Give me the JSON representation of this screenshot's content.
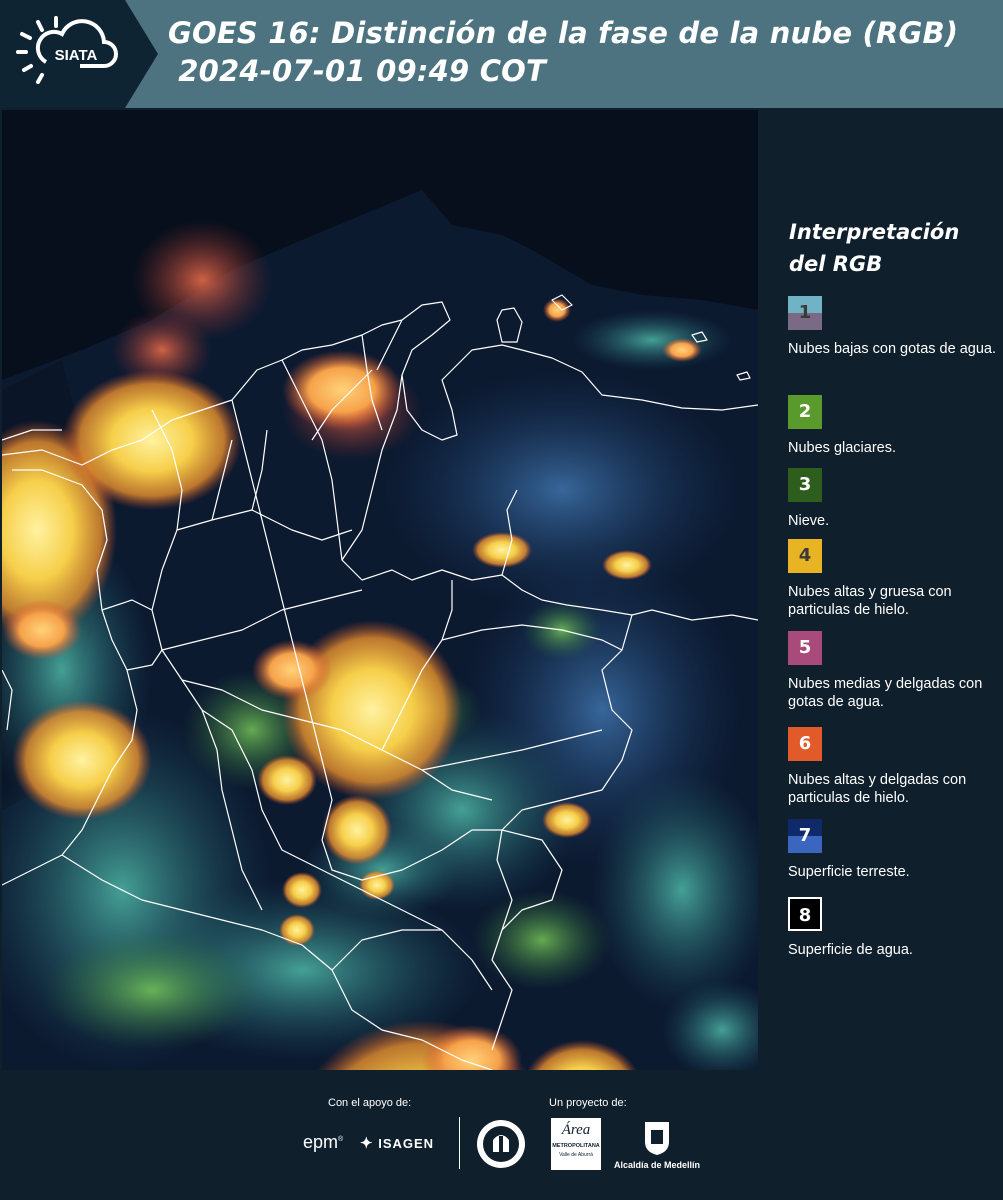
{
  "header": {
    "title_line1": "GOES 16: Distinción de la fase de la nube (RGB)",
    "title_line2": " 2024-07-01 09:49 COT",
    "logo_text": "SIATA"
  },
  "legend": {
    "title": "Interpretación del RGB",
    "items": [
      {
        "number": "1",
        "label": "Nubes bajas con gotas de agua.",
        "color_top": "#6fb3c4",
        "color_bottom": "#7a6a86"
      },
      {
        "number": "2",
        "label": "Nubes glaciares.",
        "color_top": "#5a9a2c",
        "color_bottom": "#5a9a2c"
      },
      {
        "number": "3",
        "label": "Nieve.",
        "color_top": "#2e5e1e",
        "color_bottom": "#2e5e1e"
      },
      {
        "number": "4",
        "label": "Nubes altas y gruesa con particulas de hielo.",
        "color_top": "#e8b424",
        "color_bottom": "#e8b424"
      },
      {
        "number": "5",
        "label": "Nubes medias y delgadas con gotas de agua.",
        "color_top": "#a84a7a",
        "color_bottom": "#a84a7a"
      },
      {
        "number": "6",
        "label": "Nubes altas y delgadas con particulas de hielo.",
        "color_top": "#e25a2a",
        "color_bottom": "#e25a2a"
      },
      {
        "number": "7",
        "label": "Superficie terreste.",
        "color_top": "#10296a",
        "color_bottom": "#3a66c0"
      },
      {
        "number": "8",
        "label": "Superficie de agua.",
        "color_top": "#000000",
        "color_bottom": "#000000"
      }
    ]
  },
  "footer": {
    "support_label": "Con el apoyo de:",
    "project_label": "Un proyecto de:",
    "epm": "epm",
    "isagen": "ISAGEN",
    "area_line1": "METROPOLITANA",
    "area_line2": "Valle de Aburrá",
    "area_script": "Área",
    "alcaldia": "Alcaldía de Medellín"
  }
}
